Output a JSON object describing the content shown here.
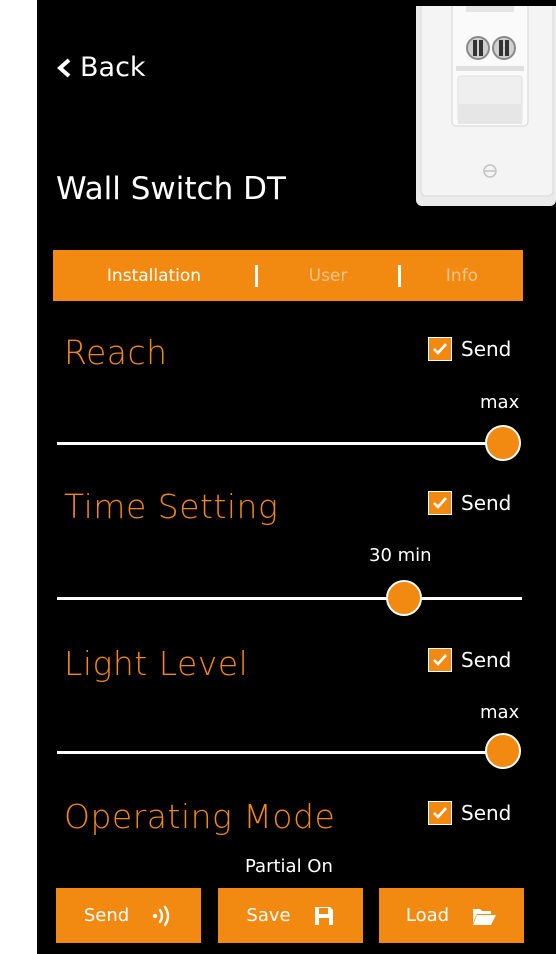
{
  "nav": {
    "back_label": "Back"
  },
  "page": {
    "title": "Wall Switch DT"
  },
  "tabs": [
    {
      "label": "Installation",
      "active": true
    },
    {
      "label": "User",
      "active": false
    },
    {
      "label": "Info",
      "active": false
    }
  ],
  "sections": {
    "reach": {
      "title": "Reach",
      "send_label": "Send",
      "send_checked": true,
      "value_label": "max",
      "slider_fraction": 1.0
    },
    "time": {
      "title": "Time Setting",
      "send_label": "Send",
      "send_checked": true,
      "value_label": "30 min",
      "slider_fraction": 0.76
    },
    "light": {
      "title": "Light Level",
      "send_label": "Send",
      "send_checked": true,
      "value_label": "max",
      "slider_fraction": 1.0
    },
    "mode": {
      "title": "Operating Mode",
      "send_label": "Send",
      "send_checked": true,
      "value_label": "Partial On"
    }
  },
  "buttons": {
    "send": {
      "label": "Send",
      "icon": "signal-icon"
    },
    "save": {
      "label": "Save",
      "icon": "floppy-disk-icon"
    },
    "load": {
      "label": "Load",
      "icon": "folder-open-icon"
    }
  },
  "colors": {
    "accent": "#F28A11",
    "background": "#000000",
    "text": "#FFFFFF"
  }
}
